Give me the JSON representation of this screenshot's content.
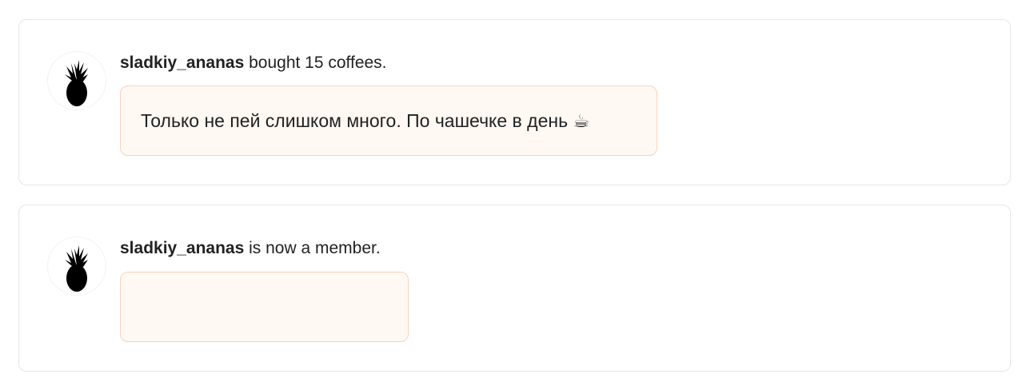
{
  "feed": {
    "items": [
      {
        "avatar_icon": "pineapple-icon",
        "username": "sladkiy_ananas",
        "action": " bought 15 coffees.",
        "message": "Только не пей слишком много. По чашечке в день ☕"
      },
      {
        "avatar_icon": "pineapple-icon",
        "username": "sladkiy_ananas",
        "action": " is now a member.",
        "message": ""
      }
    ]
  },
  "colors": {
    "card_border": "#e6e6e6",
    "message_background": "#fff8f3",
    "message_border": "#f7d3bc",
    "text": "#222222"
  }
}
